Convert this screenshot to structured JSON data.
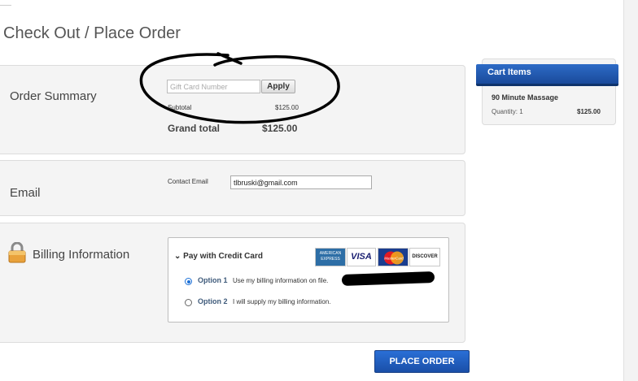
{
  "page": {
    "title": "Check Out / Place Order"
  },
  "order_summary": {
    "label": "Order Summary",
    "gift_card_placeholder": "Gift Card Number",
    "gift_card_value": "",
    "apply_label": "Apply",
    "subtotal_label": "Subtotal",
    "subtotal_value": "$125.00",
    "grand_total_label": "Grand total",
    "grand_total_value": "$125.00"
  },
  "email": {
    "label": "Email",
    "contact_label": "Contact Email",
    "contact_value": "tlbruski@gmail.com"
  },
  "billing": {
    "label": "Billing Information",
    "pay_title": "Pay with Credit Card",
    "cards": [
      "AMERICAN EXPRESS",
      "VISA",
      "MasterCard",
      "DISCOVER"
    ],
    "options": [
      {
        "name": "Option 1",
        "desc": "Use my billing information on file.",
        "selected": true
      },
      {
        "name": "Option 2",
        "desc": "I will supply my billing information.",
        "selected": false
      }
    ]
  },
  "place_order_label": "PLACE ORDER",
  "cart": {
    "title": "Cart Items",
    "item_name": "90 Minute Massage",
    "quantity_label": "Quantity: 1",
    "price": "$125.00"
  },
  "colors": {
    "accent": "#1b6fd6",
    "button": "#1a4fa8"
  }
}
